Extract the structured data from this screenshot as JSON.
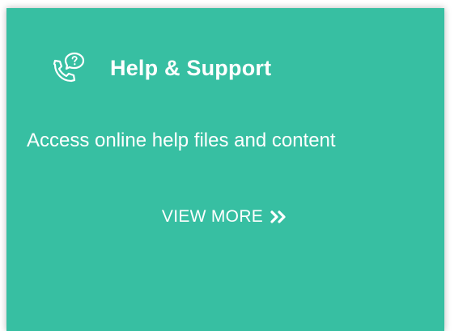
{
  "colors": {
    "card_background": "#37bfa2",
    "text": "#ffffff",
    "page_background": "#ffffff"
  },
  "card": {
    "icon": "phone-question-icon",
    "title": "Help & Support",
    "description": "Access online help files and content",
    "view_more_label": "VIEW MORE",
    "view_more_icon": "double-chevron-right-icon"
  }
}
